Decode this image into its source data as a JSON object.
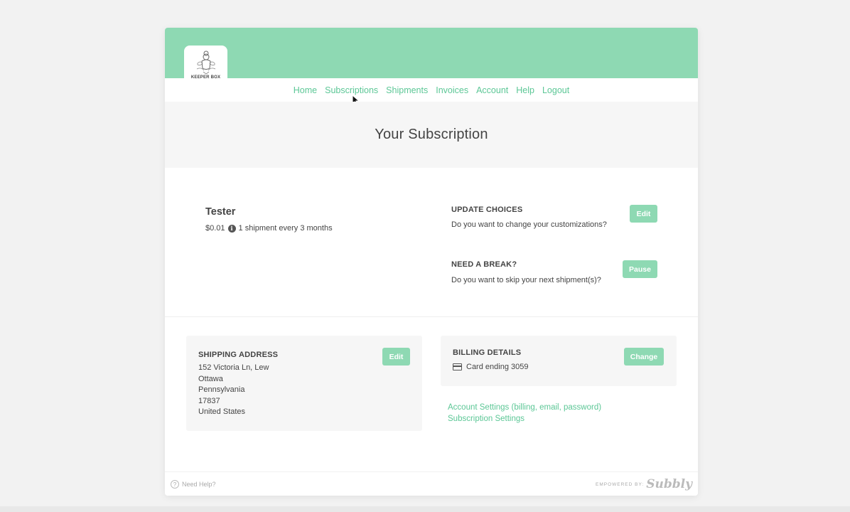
{
  "brand": {
    "logo_text": "KEEPER BOX",
    "accent_color": "#8ed9b3",
    "link_color": "#5cc796"
  },
  "nav": {
    "items": [
      "Home",
      "Subscriptions",
      "Shipments",
      "Invoices",
      "Account",
      "Help",
      "Logout"
    ]
  },
  "page": {
    "title": "Your Subscription"
  },
  "plan": {
    "name": "Tester",
    "price": "$0.01",
    "frequency": "1 shipment every 3 months"
  },
  "actions": {
    "update": {
      "title": "UPDATE CHOICES",
      "description": "Do you want to change your customizations?",
      "button": "Edit"
    },
    "pause": {
      "title": "NEED A BREAK?",
      "description": "Do you want to skip your next shipment(s)?",
      "button": "Pause"
    }
  },
  "shipping": {
    "title": "SHIPPING ADDRESS",
    "button": "Edit",
    "lines": [
      "152 Victoria Ln, Lew",
      "Ottawa",
      "Pennsylvania",
      "17837",
      "United States"
    ]
  },
  "billing": {
    "title": "BILLING DETAILS",
    "button": "Change",
    "card": "Card ending 3059"
  },
  "links": {
    "account_settings": "Account Settings (billing, email, password)",
    "subscription_settings": "Subscription Settings"
  },
  "footer": {
    "help": "Need Help?",
    "powered_label": "EMPOWERED BY:",
    "powered_brand": "Subbly"
  }
}
